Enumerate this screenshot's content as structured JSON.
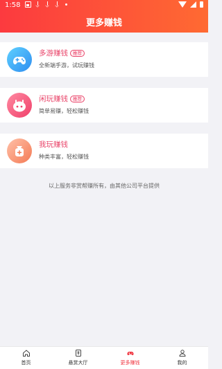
{
  "status_bar": {
    "time": "1:58"
  },
  "header": {
    "title": "更多赚钱"
  },
  "cards": [
    {
      "title": "多游赚钱",
      "badge": "推荐",
      "desc": "全新端手游，试玩赚钱",
      "title_color": "#e9456a"
    },
    {
      "title": "闲玩赚钱",
      "badge": "推荐",
      "desc": "简单易赚，轻松赚钱",
      "title_color": "#e9456a"
    },
    {
      "title": "我玩赚钱",
      "desc": "种类丰富，轻松赚钱",
      "title_color": "#e9456a"
    }
  ],
  "footer_note": "以上服务非赏帮赚所有，由其他公司平台提供",
  "tabbar": {
    "items": [
      {
        "label": "首页",
        "icon": "home-icon"
      },
      {
        "label": "悬赏大厅",
        "icon": "task-icon"
      },
      {
        "label": "更多赚钱",
        "icon": "gamepad-icon",
        "active": true
      },
      {
        "label": "我的",
        "icon": "user-icon"
      }
    ]
  },
  "colors": {
    "header_start": "#fc3a3f",
    "header_end": "#ff6a32",
    "accent": "#f0323d",
    "badge": "#e9456a"
  }
}
